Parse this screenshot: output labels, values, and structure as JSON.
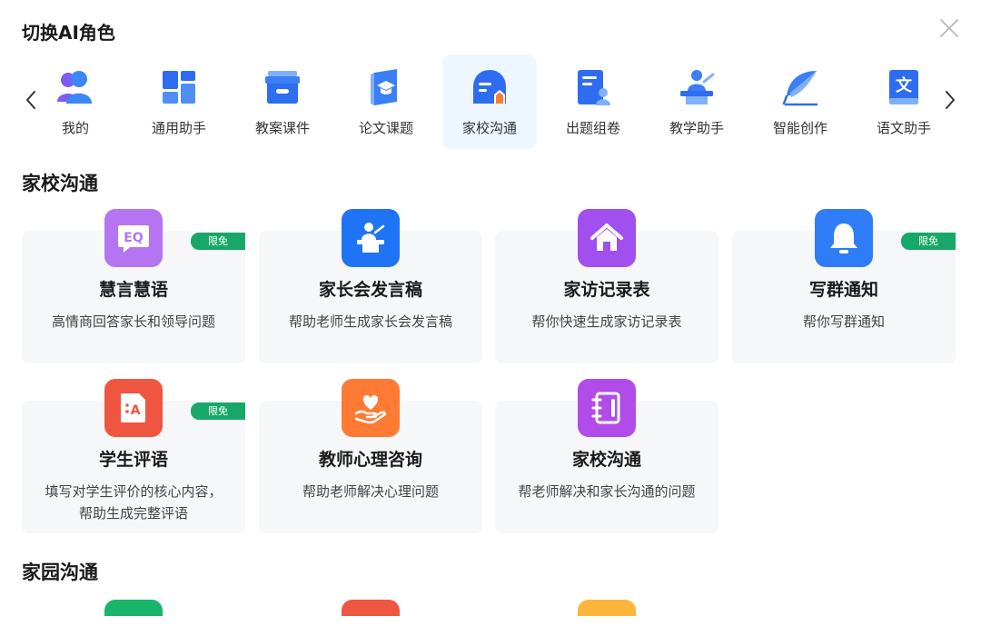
{
  "dialog": {
    "title": "切换AI角色"
  },
  "roles": [
    {
      "label": "我的",
      "icon": "user-group-icon"
    },
    {
      "label": "通用助手",
      "icon": "grid-layout-icon"
    },
    {
      "label": "教案课件",
      "icon": "archive-box-icon"
    },
    {
      "label": "论文课题",
      "icon": "graduation-book-icon"
    },
    {
      "label": "家校沟通",
      "icon": "school-chat-icon",
      "active": true
    },
    {
      "label": "出题组卷",
      "icon": "exam-paper-icon"
    },
    {
      "label": "教学助手",
      "icon": "teacher-podium-icon"
    },
    {
      "label": "智能创作",
      "icon": "quill-pen-icon"
    },
    {
      "label": "语文助手",
      "icon": "chinese-book-icon"
    }
  ],
  "sections": [
    {
      "title": "家校沟通",
      "cards": [
        {
          "title": "慧言慧语",
          "desc": "高情商回答家长和领导问题",
          "badge": "限免",
          "icon": "eq-chat-icon",
          "color": "#b574f2"
        },
        {
          "title": "家长会发言稿",
          "desc": "帮助老师生成家长会发言稿",
          "icon": "speaker-podium-icon",
          "color": "#1f74f5"
        },
        {
          "title": "家访记录表",
          "desc": "帮你快速生成家访记录表",
          "icon": "home-icon",
          "color": "#a24ff0"
        },
        {
          "title": "写群通知",
          "desc": "帮你写群通知",
          "badge": "限免",
          "icon": "bell-icon",
          "color": "#2f7df6"
        },
        {
          "title": "学生评语",
          "desc": "填写对学生评价的核心内容，帮助生成完整评语",
          "badge": "限免",
          "icon": "comment-card-icon",
          "color": "#ef5641"
        },
        {
          "title": "教师心理咨询",
          "desc": "帮助老师解决心理问题",
          "icon": "heart-hand-icon",
          "color": "#ff7a33"
        },
        {
          "title": "家校沟通",
          "desc": "帮老师解决和家长沟通的问题",
          "icon": "notebook-icon",
          "color": "#b14cea"
        }
      ]
    },
    {
      "title": "家园沟通"
    }
  ],
  "peek_colors": [
    "#19b56a",
    "#ef5641",
    "#fbb53a"
  ]
}
